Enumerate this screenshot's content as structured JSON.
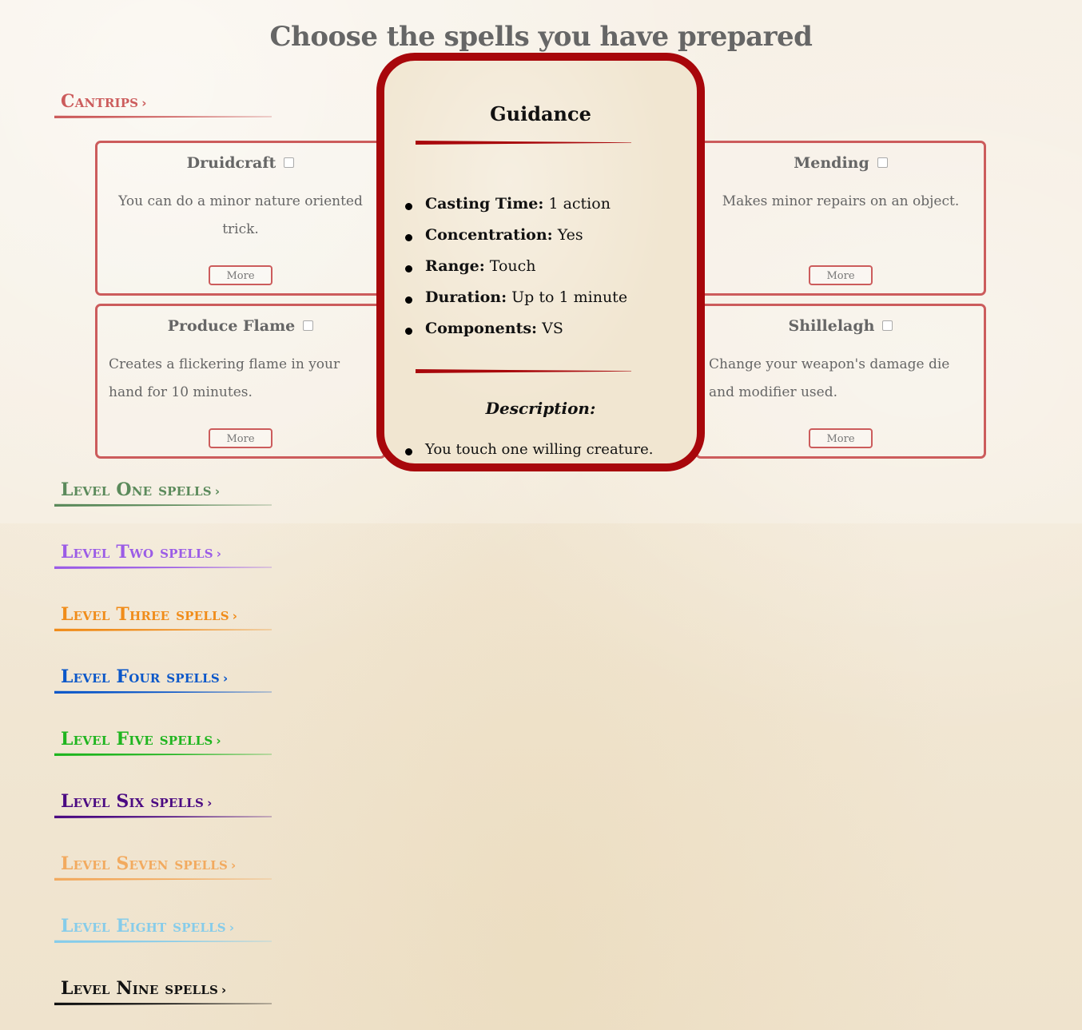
{
  "page": {
    "title": "Choose the spells you have prepared"
  },
  "sections": [
    {
      "label": "Cantrips",
      "chevron": "›",
      "color": "#cc5c5c"
    },
    {
      "label": "Level One spells",
      "chevron": "›",
      "color": "#5b8a5b"
    },
    {
      "label": "Level Two spells",
      "chevron": "›",
      "color": "#9b5ce6"
    },
    {
      "label": "Level Three spells",
      "chevron": "›",
      "color": "#f08c1a"
    },
    {
      "label": "Level Four spells",
      "chevron": "›",
      "color": "#0b57c9"
    },
    {
      "label": "Level Five spells",
      "chevron": "›",
      "color": "#1fb51f"
    },
    {
      "label": "Level Six spells",
      "chevron": "›",
      "color": "#4b0a82"
    },
    {
      "label": "Level Seven spells",
      "chevron": "›",
      "color": "#f2aa5f"
    },
    {
      "label": "Level Eight spells",
      "chevron": "›",
      "color": "#86ccea"
    },
    {
      "label": "Level Nine spells",
      "chevron": "›",
      "color": "#111111"
    }
  ],
  "cantrips": [
    {
      "name": "Druidcraft",
      "description": "You can do a minor nature oriented trick.",
      "more_label": "More",
      "checked": false
    },
    {
      "name": "Mending",
      "description": "Makes minor repairs on an object.",
      "more_label": "More",
      "checked": false
    },
    {
      "name": "Produce Flame",
      "description": "Creates a flickering flame in your hand for 10 minutes.",
      "more_label": "More",
      "checked": false
    },
    {
      "name": "Shillelagh",
      "description": "Change your weapon's damage die and modifier used.",
      "more_label": "More",
      "checked": false
    }
  ],
  "modal": {
    "title": "Guidance",
    "accent_color": "#a8070b",
    "properties": [
      {
        "label": "Casting Time:",
        "value": "1 action"
      },
      {
        "label": "Concentration:",
        "value": "Yes"
      },
      {
        "label": "Range:",
        "value": "Touch"
      },
      {
        "label": "Duration:",
        "value": "Up to 1 minute"
      },
      {
        "label": "Components:",
        "value": "VS"
      }
    ],
    "description_heading": "Description:",
    "description_text": "You touch one willing creature. Once before the spell ends, the target"
  }
}
